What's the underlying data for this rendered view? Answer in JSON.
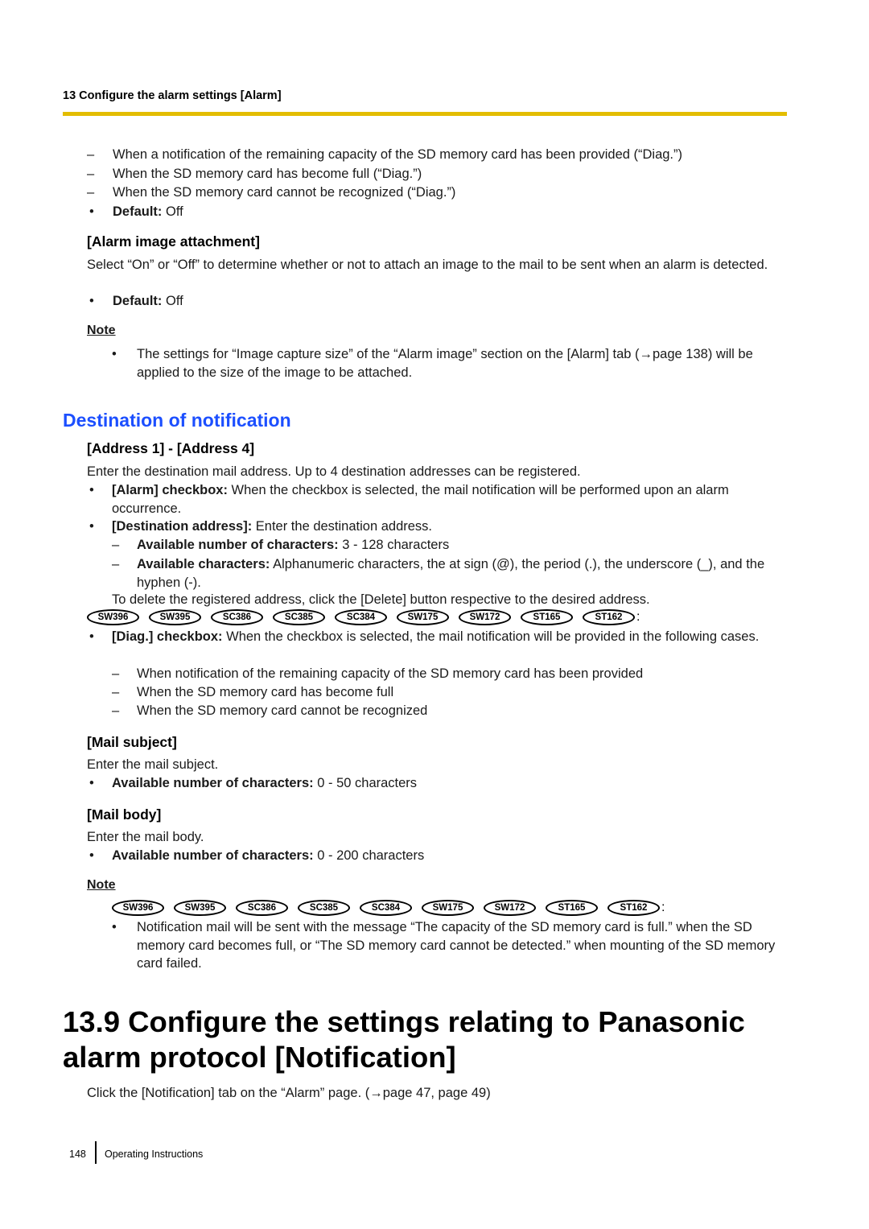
{
  "header": {
    "running_head": "13 Configure the alarm settings [Alarm]",
    "rule_color": "#e3bd00"
  },
  "top_list": {
    "items": [
      "When a notification of the remaining capacity of the SD memory card has been provided (“Diag.”)",
      "When the SD memory card has become full (“Diag.”)",
      "When the SD memory card cannot be recognized (“Diag.”)"
    ],
    "default_label": "Default:",
    "default_value": " Off"
  },
  "alarm_image": {
    "heading": "[Alarm image attachment]",
    "description": "Select “On” or “Off” to determine whether or not to attach an image to the mail to be sent when an alarm is detected.",
    "default_label": "Default:",
    "default_value": " Off",
    "note_label": "Note",
    "note_text": "The settings for “Image capture size” of the “Alarm image” section on the [Alarm] tab (→page 138) will be applied to the size of the image to be attached."
  },
  "destination": {
    "heading": "Destination of notification",
    "heading_color": "#1c4fff",
    "address": {
      "heading": "[Address 1] - [Address 4]",
      "description": "Enter the destination mail address. Up to 4 destination addresses can be registered.",
      "alarm_checkbox_label": "[Alarm] checkbox:",
      "alarm_checkbox_text": " When the checkbox is selected, the mail notification will be performed upon an alarm occurrence.",
      "dest_addr_label": "[Destination address]:",
      "dest_addr_text": " Enter the destination address.",
      "num_chars_label": "Available number of characters:",
      "num_chars_text": " 3 - 128 characters",
      "avail_chars_label": "Available characters:",
      "avail_chars_text": " Alphanumeric characters, the at sign (@), the period (.), the underscore (_), and the hyphen (-).",
      "delete_text": "To delete the registered address, click the [Delete] button respective to the desired address.",
      "models": [
        "SW396",
        "SW395",
        "SC386",
        "SC385",
        "SC384",
        "SW175",
        "SW172",
        "ST165",
        "ST162"
      ],
      "models_suffix": ":",
      "diag_label": "[Diag.] checkbox:",
      "diag_text": " When the checkbox is selected, the mail notification will be provided in the following cases.",
      "diag_cases": [
        "When notification of the remaining capacity of the SD memory card has been provided",
        "When the SD memory card has become full",
        "When the SD memory card cannot be recognized"
      ]
    },
    "mail_subject": {
      "heading": "[Mail subject]",
      "description": "Enter the mail subject.",
      "num_chars_label": "Available number of characters:",
      "num_chars_text": " 0 - 50 characters"
    },
    "mail_body": {
      "heading": "[Mail body]",
      "description": "Enter the mail body.",
      "num_chars_label": "Available number of characters:",
      "num_chars_text": " 0 - 200 characters",
      "note_label": "Note",
      "models": [
        "SW396",
        "SW395",
        "SC386",
        "SC385",
        "SC384",
        "SW175",
        "SW172",
        "ST165",
        "ST162"
      ],
      "models_suffix": ":",
      "note_text": "Notification mail will be sent with the message “The capacity of the SD memory card is full.” when the SD memory card becomes full, or “The SD memory card cannot be detected.” when mounting of the SD memory card failed."
    }
  },
  "section_13_9": {
    "heading": "13.9  Configure the settings relating to Panasonic alarm protocol [Notification]",
    "intro": "Click the [Notification] tab on the “Alarm” page. (→page 47, page 49)"
  },
  "footer": {
    "page_number": "148",
    "label": "Operating Instructions"
  }
}
